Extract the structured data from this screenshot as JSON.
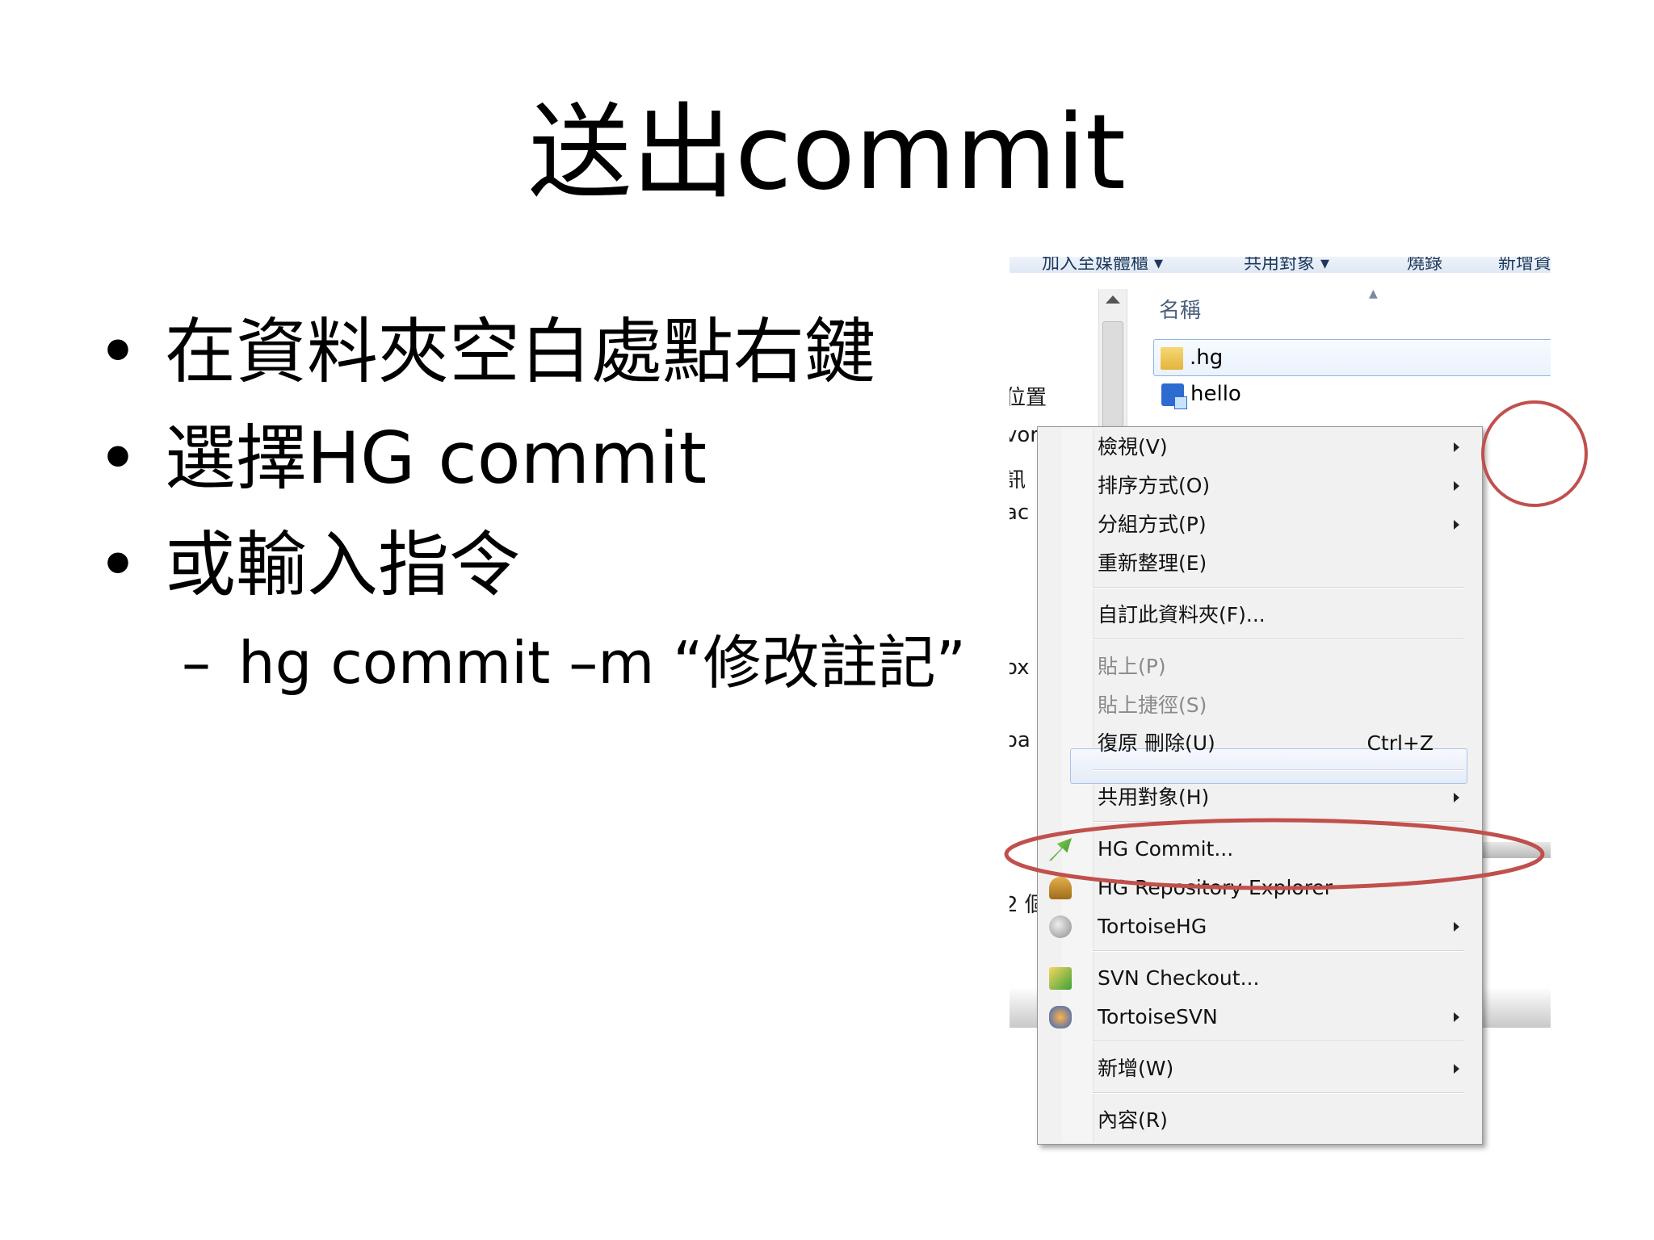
{
  "title": "送出commit",
  "bullets": [
    {
      "marker": "•",
      "text": "在資料夾空白處點右鍵"
    },
    {
      "marker": "•",
      "text": "選擇HG commit"
    },
    {
      "marker": "•",
      "text": "或輸入指令"
    }
  ],
  "sub_bullet": {
    "marker": "–",
    "text": "hg commit –m “修改註記”"
  },
  "explorer": {
    "toolbar_items": [
      "加入至媒體櫃 ▾",
      "共用對象 ▾",
      "燒錄",
      "新增資"
    ],
    "column_header": "名稱",
    "files": [
      {
        "name": ".hg",
        "icon": "folder-icon"
      },
      {
        "name": "hello",
        "icon": "file-icon"
      }
    ],
    "left_fragments": [
      "位置",
      "vor",
      "訊",
      "ac",
      "ox",
      "oa",
      "2 個"
    ]
  },
  "context_menu": {
    "groups": [
      [
        {
          "label": "檢視(V)",
          "submenu": true
        },
        {
          "label": "排序方式(O)",
          "submenu": true
        },
        {
          "label": "分組方式(P)",
          "submenu": true
        },
        {
          "label": "重新整理(E)",
          "submenu": false
        }
      ],
      [
        {
          "label": "自訂此資料夾(F)...",
          "submenu": false
        }
      ],
      [
        {
          "label": "貼上(P)",
          "submenu": false,
          "disabled": true
        },
        {
          "label": "貼上捷徑(S)",
          "submenu": false,
          "disabled": true
        },
        {
          "label": "復原 刪除(U)",
          "submenu": false,
          "shortcut": "Ctrl+Z"
        }
      ],
      [
        {
          "label": "共用對象(H)",
          "submenu": true
        }
      ],
      [
        {
          "label": "HG Commit...",
          "submenu": false,
          "icon": "hg-commit-icon",
          "highlighted": true
        },
        {
          "label": "HG Repository Explorer",
          "submenu": false,
          "icon": "hg-repo-explorer-icon"
        },
        {
          "label": "TortoiseHG",
          "submenu": true,
          "icon": "tortoisehg-icon"
        }
      ],
      [
        {
          "label": "SVN Checkout...",
          "submenu": false,
          "icon": "svn-checkout-icon"
        },
        {
          "label": "TortoiseSVN",
          "submenu": true,
          "icon": "tortoisesvn-icon"
        }
      ],
      [
        {
          "label": "新增(W)",
          "submenu": true
        }
      ],
      [
        {
          "label": "內容(R)",
          "submenu": false
        }
      ]
    ]
  },
  "annotation_color": "#c0504d"
}
